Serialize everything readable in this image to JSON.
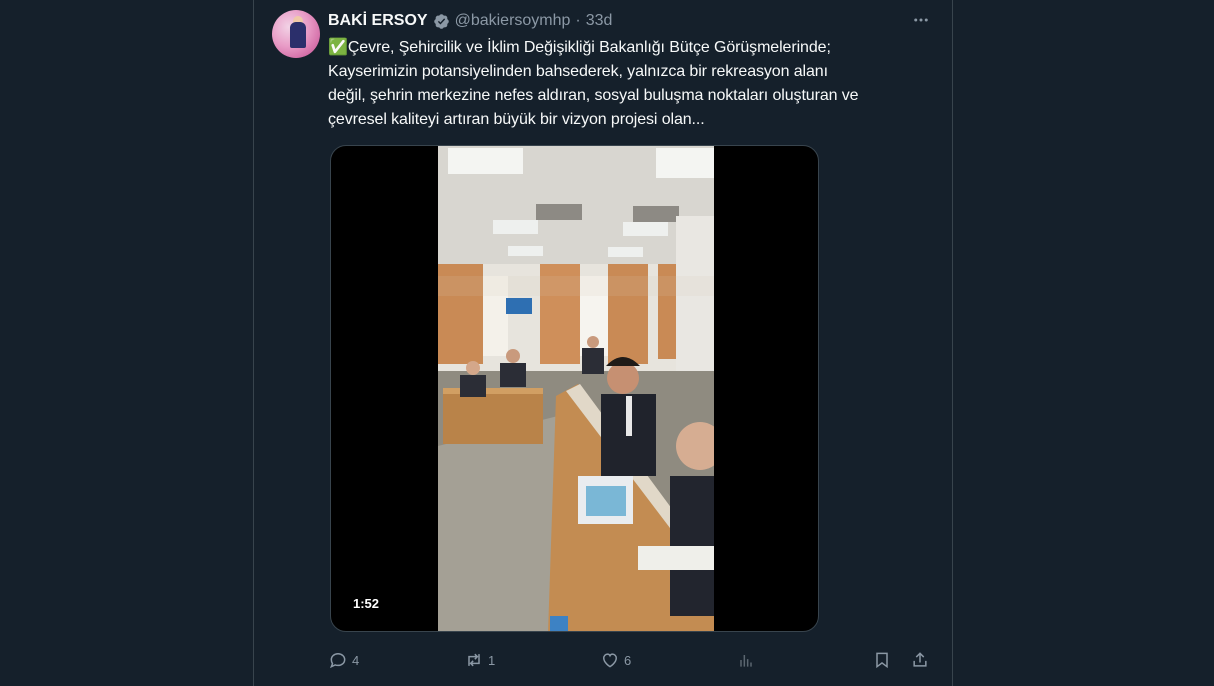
{
  "tweet": {
    "author_name": "BAKİ ERSOY",
    "handle": "@bakiersoymhp",
    "separator": "·",
    "time_ago": "33d",
    "text_lines": [
      "✅Çevre, Şehircilik ve İklim Değişikliği Bakanlığı Bütçe Görüşmelerinde;",
      "Kayserimizin potansiyelinden bahsederek, yalnızca bir rekreasyon alanı",
      "değil, şehrin merkezine nefes aldıran, sosyal buluşma noktaları oluşturan ve",
      "çevresel kaliteyi artıran büyük bir vizyon projesi olan..."
    ],
    "video_duration": "1:52"
  },
  "actions": {
    "reply_count": "4",
    "repost_count": "1",
    "like_count": "6"
  },
  "icons": {
    "verified": "verified-badge-icon",
    "more": "more-options-icon",
    "reply": "reply-icon",
    "repost": "repost-icon",
    "like": "like-icon",
    "views": "views-icon",
    "bookmark": "bookmark-icon",
    "share": "share-icon"
  },
  "colors": {
    "background": "#15202b",
    "border": "#38444d",
    "text": "#f7f9f9",
    "secondary_text": "#8b98a5"
  }
}
